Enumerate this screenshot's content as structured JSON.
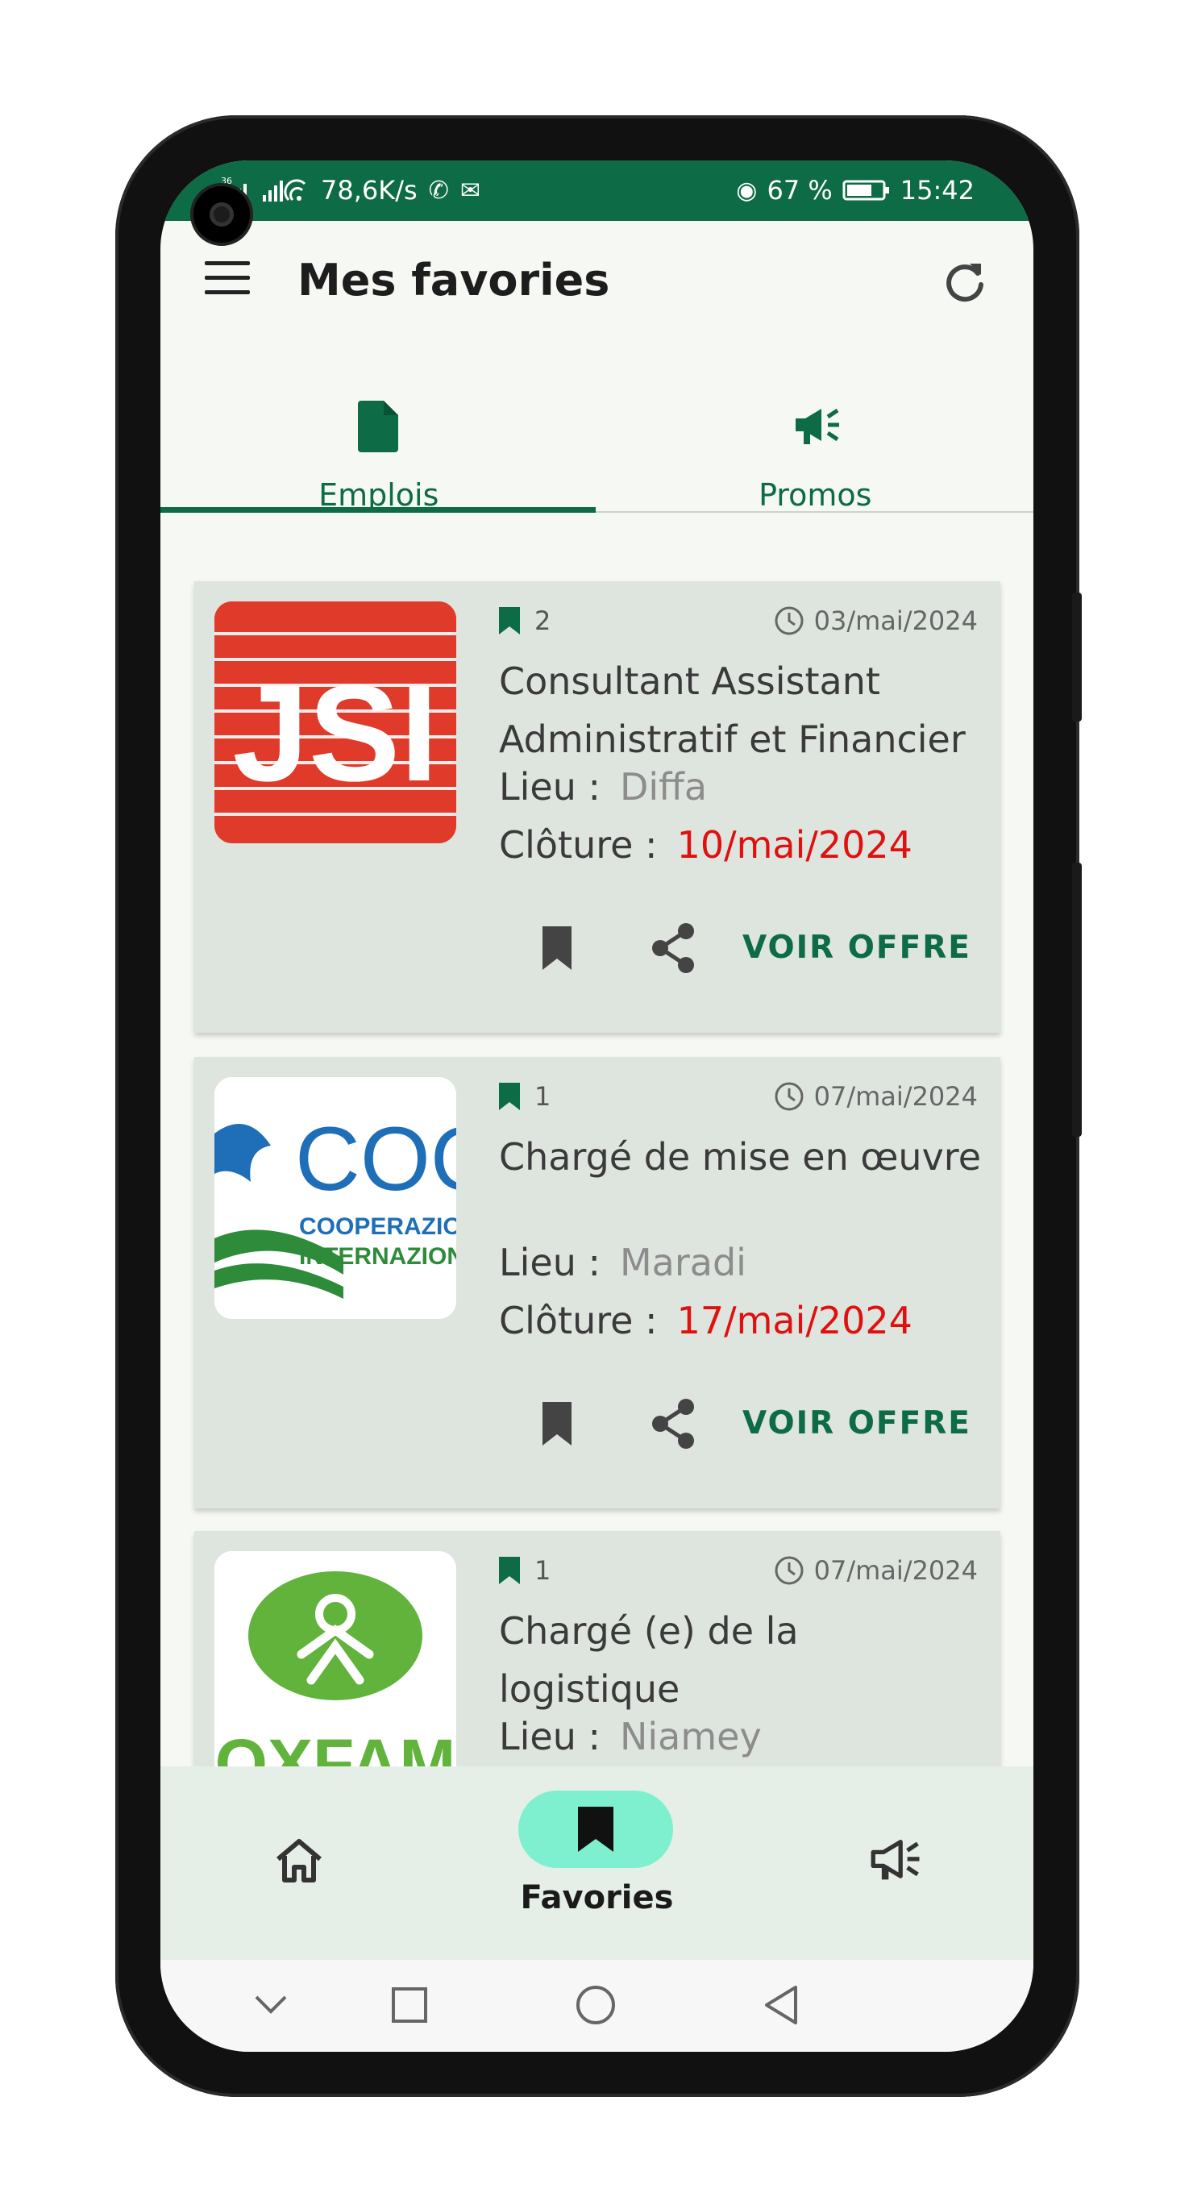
{
  "status_bar": {
    "left_text": "78,6K/s",
    "signal_label": "36",
    "battery": "67 %",
    "time": "15:42"
  },
  "header": {
    "title": "Mes favories"
  },
  "tabs": [
    {
      "label": "Emplois",
      "icon": "document-icon",
      "active": true
    },
    {
      "label": "Promos",
      "icon": "megaphone-icon",
      "active": false
    }
  ],
  "jobs": [
    {
      "logo": "JSI",
      "bookmark_count": "2",
      "date": "03/mai/2024",
      "title_line1": "Consultant Assistant",
      "title_line2": "Administratif et Financier",
      "lieu_label": "Lieu :",
      "lieu": "Diffa",
      "cloture_label": "Clôture :",
      "cloture": "10/mai/2024",
      "action_label": "VOIR OFFRE"
    },
    {
      "logo": "COOPERAZIONE INTERNAZIONALE",
      "logo_word": "COOP",
      "logo_line1": "COOPERAZIONE",
      "logo_line2": "INTERNAZIONALE",
      "bookmark_count": "1",
      "date": "07/mai/2024",
      "title_line1": "Chargé de mise en œuvre",
      "title_line2": "",
      "lieu_label": "Lieu :",
      "lieu": "Maradi",
      "cloture_label": "Clôture :",
      "cloture": "17/mai/2024",
      "action_label": "VOIR OFFRE"
    },
    {
      "logo": "OXFAM",
      "bookmark_count": "1",
      "date": "07/mai/2024",
      "title_line1": "Chargé (e) de la",
      "title_line2": "logistique",
      "lieu_label": "Lieu :",
      "lieu": "Niamey"
    }
  ],
  "bottom_nav": {
    "home_icon": "home-icon",
    "favories_label": "Favories",
    "promo_icon": "megaphone-icon"
  },
  "colors": {
    "primary": "#0d6b45",
    "card_bg": "#dde5de",
    "deadline": "#e01010",
    "nav_pill": "#7ef0cf"
  }
}
